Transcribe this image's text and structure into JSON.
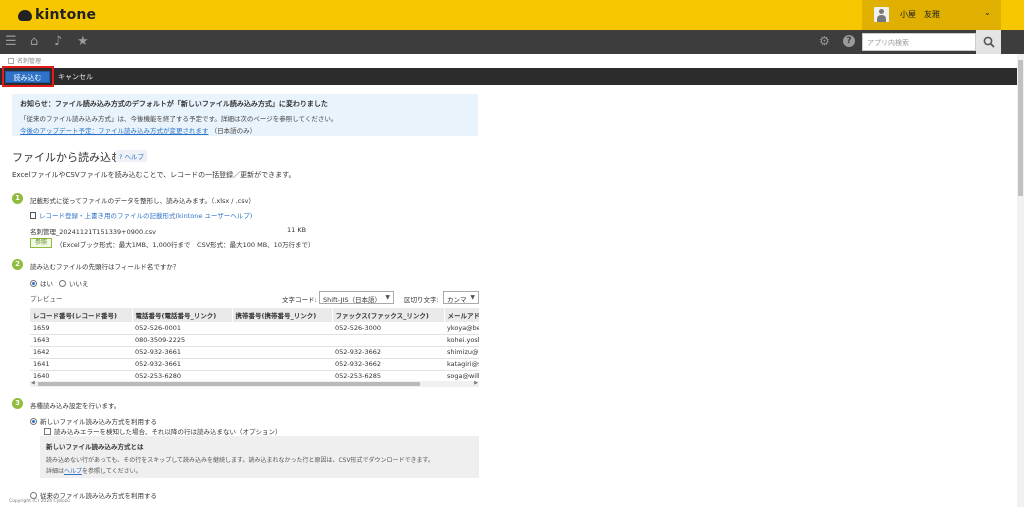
{
  "app": {
    "logo_text": "kintone",
    "user_name": "小屋　友雅",
    "search_placeholder": "アプリ内検索"
  },
  "breadcrumb": {
    "app_name": "名刺管理"
  },
  "toolbar": {
    "import_label": "読み込む",
    "cancel_label": "キャンセル"
  },
  "notice": {
    "title": "お知らせ：ファイル読み込み方式のデフォルトが「新しいファイル読み込み方式」に変わりました",
    "line1": "「従来のファイル読み込み方式」は、今後機能を終了する予定です。詳細は次のページを参照してください。",
    "link": "今後のアップデート予定：ファイル読み込み方式が変更されます",
    "link_suffix": "（日本語のみ）"
  },
  "page": {
    "title": "ファイルから読み込む",
    "help_label": "ヘルプ",
    "description": "ExcelファイルやCSVファイルを読み込むことで、レコードの一括登録／更新ができます。"
  },
  "steps": {
    "step1": {
      "num": "1",
      "text": "記載形式に従ってファイルのデータを整形し、読み込みます。（.xlsx / .csv）",
      "format_link": "レコード登録・上書き用のファイルの記載形式(kintone ユーザーヘルプ)",
      "file_name": "名刺管理_20241121T151339+0900.csv",
      "file_size": "11 KB",
      "browse_label": "参照",
      "limit_note": "（Excelブック形式：最大1MB、1,000行まで　CSV形式：最大100 MB、10万行まで）"
    },
    "step2": {
      "num": "2",
      "text": "読み込むファイルの先頭行はフィールド名ですか？",
      "yes_label": "はい",
      "no_label": "いいえ",
      "preview_label": "プレビュー",
      "encoding_label": "文字コード:",
      "encoding_value": "Shift-JIS（日本語）",
      "separator_label": "区切り文字:",
      "separator_value": "カンマ"
    },
    "step3": {
      "num": "3",
      "text": "各種読み込み設定を行います。",
      "new_method_label": "新しいファイル読み込み方式を利用する",
      "skip_error_label": "読み込みエラーを検知した場合、それ以降の行は読み込まない（オプション）",
      "info_title": "新しいファイル読み込み方式とは",
      "info_line1": "読み込めない行があっても、その行をスキップして読み込みを継続します。読み込まれなかった行と原因は、CSV形式でダウンロードできます。",
      "info_line2_prefix": "詳細は",
      "info_line2_link": "ヘルプ",
      "info_line2_suffix": "を参照してください。",
      "old_method_label": "従来のファイル読み込み方式を利用する"
    }
  },
  "preview_table": {
    "headers": [
      "レコード番号(レコード番号)",
      "電話番号(電話番号_リンク)",
      "携帯番号(携帯番号_リンク)",
      "ファックス(ファックス_リンク)",
      "メールアドレス"
    ],
    "rows": [
      [
        "1659",
        "052-526-0001",
        "",
        "052-526-3000",
        "ykoya@be"
      ],
      [
        "1643",
        "080-3509-2225",
        "",
        "",
        "kohei.yosh"
      ],
      [
        "1642",
        "052-932-3661",
        "",
        "052-932-3662",
        "shimizu@s"
      ],
      [
        "1641",
        "052-932-3661",
        "",
        "052-932-3662",
        "katagiri@s"
      ],
      [
        "1640",
        "052-253-6280",
        "",
        "052-253-6285",
        "soga@will"
      ]
    ]
  },
  "footer": {
    "copyright": "Copyright (C) 2024 Cybozu"
  }
}
